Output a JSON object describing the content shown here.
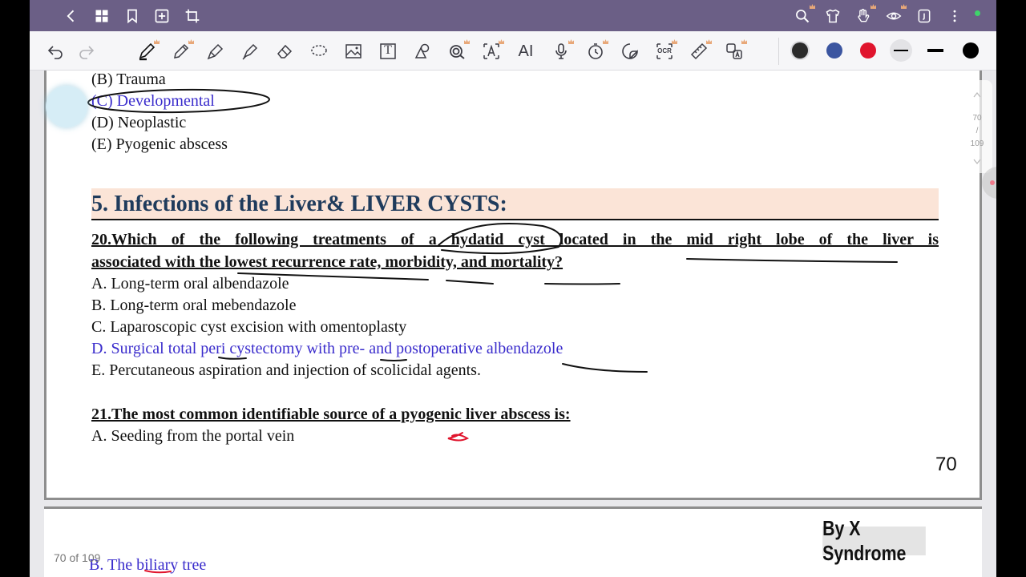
{
  "toolbar_top": {
    "icons": [
      "back-icon",
      "grid-icon",
      "bookmark-icon",
      "add-page-icon",
      "crop-icon",
      "search-icon",
      "shirt-icon",
      "hand-icon",
      "eye-icon",
      "document-icon",
      "more-icon"
    ]
  },
  "tools": {
    "icons": [
      "undo-icon",
      "redo-icon",
      "pen-icon",
      "pencil-icon",
      "fountain-pen-icon",
      "highlighter-icon",
      "eraser-icon",
      "lasso-icon",
      "image-icon",
      "text-icon",
      "shapes-icon",
      "magnifier-icon",
      "translate-icon",
      "ai-icon",
      "microphone-icon",
      "timer-icon",
      "sticker-icon",
      "ocr-icon",
      "ruler-icon",
      "translate-doc-icon"
    ],
    "text_tool_label": "T",
    "ai_label": "AI",
    "ocr_label": "OCR",
    "colors": [
      "#2b2b2b",
      "#3b55a0",
      "#e0152d",
      "#000000",
      "#000000"
    ]
  },
  "document": {
    "option_b": "(B) Trauma",
    "option_c": "(C) Developmental",
    "option_d": "(D) Neoplastic",
    "option_e": "(E) Pyogenic abscess",
    "section_heading": "5. Infections of the Liver& LIVER CYSTS:",
    "q20_line1": "20.Which of the following treatments of a hydatid cyst located in the mid right lobe of the liver is",
    "q20_line2": "associated with the lowest recurrence rate, morbidity, and mortality?",
    "q20_a": "A. Long-term oral albendazole",
    "q20_b": "B. Long-term oral mebendazole",
    "q20_c": "C. Laparoscopic cyst excision with omentoplasty",
    "q20_d": "D. Surgical total peri cystectomy with pre- and postoperative albendazole",
    "q20_e": "E. Percutaneous aspiration and injection of scolicidal agents.",
    "q21": "21.The most common identifiable source of a pyogenic liver abscess is:",
    "q21_a": "A. Seeding from the portal vein",
    "q21_b": "B. The biliary tree",
    "page_number": "70",
    "brand": "By X Syndrome"
  },
  "navigation": {
    "current_page": "70",
    "slash": "/",
    "total_pages": "109",
    "page_count_label": "70 of 109"
  }
}
